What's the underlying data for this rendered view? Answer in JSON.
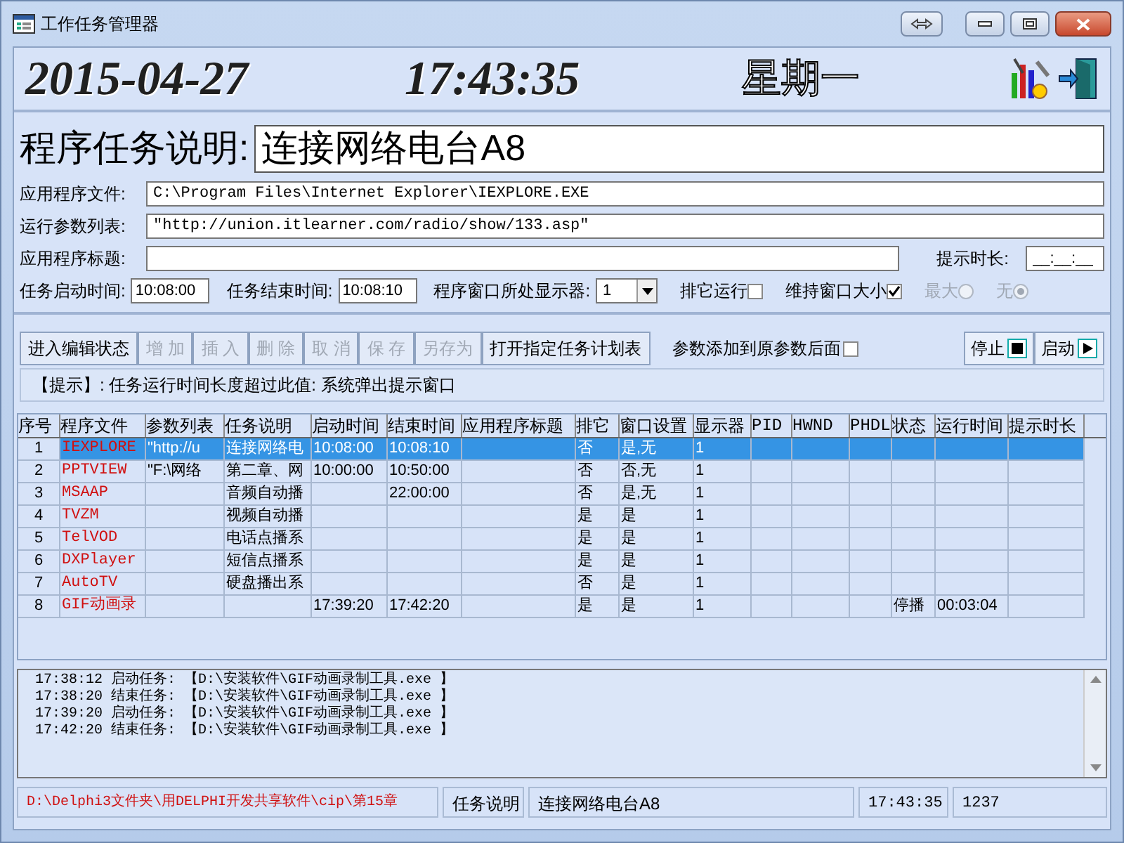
{
  "window": {
    "title": "工作任务管理器"
  },
  "header": {
    "date": "2015-04-27",
    "time": "17:43:35",
    "weekday": "星期一"
  },
  "task_description": {
    "label": "程序任务说明:",
    "value": "连接网络电台A8"
  },
  "form": {
    "app_file": {
      "label": "应用程序文件:",
      "value": "C:\\Program Files\\Internet Explorer\\IEXPLORE.EXE"
    },
    "params": {
      "label": "运行参数列表:",
      "value": "\"http://union.itlearner.com/radio/show/133.asp\""
    },
    "app_title": {
      "label": "应用程序标题:"
    },
    "hint_duration": {
      "label": "提示时长:",
      "value": "__:__:__"
    },
    "start_time": {
      "label": "任务启动时间:",
      "value": "10:08:00"
    },
    "end_time": {
      "label": "任务结束时间:",
      "value": "10:08:10"
    },
    "monitor": {
      "label": "程序窗口所处显示器:",
      "value": "1"
    },
    "options": [
      {
        "kind": "checkbox",
        "label": "排它运行",
        "checked": false,
        "disabled": false
      },
      {
        "kind": "checkbox",
        "label": "维持窗口大小",
        "checked": true,
        "disabled": false
      },
      {
        "kind": "radio",
        "label": "最大",
        "checked": false,
        "disabled": true
      },
      {
        "kind": "radio",
        "label": "无",
        "checked": true,
        "disabled": true
      }
    ]
  },
  "toolbar": {
    "buttons": [
      {
        "label": "进入编辑状态",
        "disabled": false
      },
      {
        "label": "增 加",
        "disabled": true
      },
      {
        "label": "插 入",
        "disabled": true
      },
      {
        "label": "删 除",
        "disabled": true
      },
      {
        "label": "取 消",
        "disabled": true
      },
      {
        "label": "保 存",
        "disabled": true
      },
      {
        "label": "另存为",
        "disabled": true
      },
      {
        "label": "打开指定任务计划表",
        "disabled": false
      }
    ],
    "append_params": {
      "label": "参数添加到原参数后面",
      "checked": false
    },
    "stop_button": {
      "label": "停止"
    },
    "start_button": {
      "label": "启动"
    }
  },
  "hint": "【提示】: 任务运行时间长度超过此值: 系统弹出提示窗口",
  "table": {
    "columns": [
      "序号",
      "程序文件",
      "参数列表",
      "任务说明",
      "启动时间",
      "结束时间",
      "应用程序标题",
      "排它",
      "窗口设置",
      "显示器",
      "PID",
      "HWND",
      "PHDL",
      "状态",
      "运行时间",
      "提示时长"
    ],
    "rows": [
      {
        "selected": true,
        "cells": {
          "0": "1",
          "1": "IEXPLORE",
          "2": "\"http://u",
          "3": "连接网络电",
          "4": "10:08:00",
          "5": "10:08:10",
          "7": "否",
          "8": "是,无",
          "9": "1"
        }
      },
      {
        "selected": false,
        "cells": {
          "0": "2",
          "1": "PPTVIEW",
          "2": "\"F:\\网络",
          "3": "第二章、网",
          "4": "10:00:00",
          "5": "10:50:00",
          "7": "否",
          "8": "否,无",
          "9": "1"
        }
      },
      {
        "selected": false,
        "cells": {
          "0": "3",
          "1": "MSAAP",
          "3": "音频自动播",
          "5": "22:00:00",
          "7": "否",
          "8": "是,无",
          "9": "1"
        }
      },
      {
        "selected": false,
        "cells": {
          "0": "4",
          "1": "TVZM",
          "3": "视频自动播",
          "7": "是",
          "8": "是",
          "9": "1"
        }
      },
      {
        "selected": false,
        "cells": {
          "0": "5",
          "1": "TelVOD",
          "3": "电话点播系",
          "7": "是",
          "8": "是",
          "9": "1"
        }
      },
      {
        "selected": false,
        "cells": {
          "0": "6",
          "1": "DXPlayer",
          "3": "短信点播系",
          "7": "是",
          "8": "是",
          "9": "1"
        }
      },
      {
        "selected": false,
        "cells": {
          "0": "7",
          "1": "AutoTV",
          "3": "硬盘播出系",
          "7": "否",
          "8": "是",
          "9": "1"
        }
      },
      {
        "selected": false,
        "cells": {
          "0": "8",
          "1": "GIF动画录",
          "4": "17:39:20",
          "5": "17:42:20",
          "7": "是",
          "8": "是",
          "9": "1",
          "13": "停播",
          "14": "00:03:04"
        }
      }
    ]
  },
  "log": [
    "17:38:12 启动任务: 【D:\\安装软件\\GIF动画录制工具.exe 】",
    "17:38:20 结束任务: 【D:\\安装软件\\GIF动画录制工具.exe 】",
    "17:39:20 启动任务: 【D:\\安装软件\\GIF动画录制工具.exe 】",
    "17:42:20 结束任务: 【D:\\安装软件\\GIF动画录制工具.exe 】"
  ],
  "status_bar": [
    "D:\\Delphi3文件夹\\用DELPHI开发共享软件\\cip\\第15章",
    "任务说明",
    "连接网络电台A8",
    "17:43:35",
    "1237"
  ]
}
